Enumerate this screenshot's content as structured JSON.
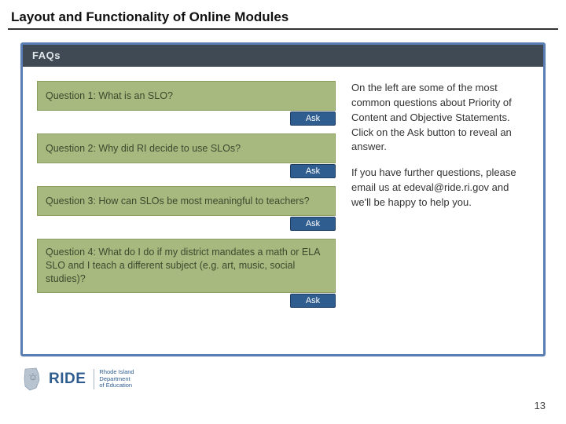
{
  "title": "Layout and Functionality of Online Modules",
  "module": {
    "header": "FAQs",
    "questions": [
      {
        "text": "Question 1: What is an SLO?",
        "ask": "Ask"
      },
      {
        "text": "Question 2: Why did RI decide to use SLOs?",
        "ask": "Ask"
      },
      {
        "text": "Question 3: How can SLOs be most meaningful to teachers?",
        "ask": "Ask"
      },
      {
        "text": "Question 4: What do I do if my district mandates a math or ELA SLO and I teach a different subject (e.g. art, music, social studies)?",
        "ask": "Ask"
      }
    ],
    "info_p1": "On the left are some of the most common questions about Priority of Content and Objective Statements.  Click on the Ask button to reveal an answer.",
    "info_p2": "If you have further questions, please email us at edeval@ride.ri.gov and we'll be happy to help you."
  },
  "logo": {
    "word": "RIDE",
    "sub1": "Rhode Island",
    "sub2": "Department",
    "sub3": "of Education"
  },
  "page_number": "13"
}
